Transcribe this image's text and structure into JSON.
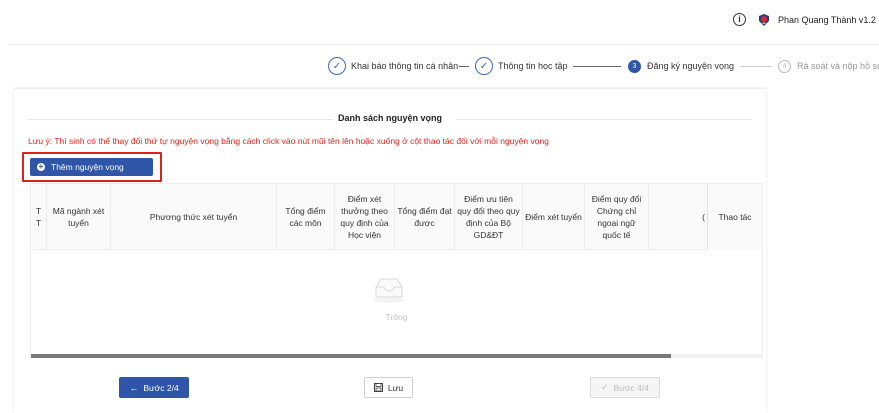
{
  "header": {
    "info_icon": "info-circle-icon",
    "avatar_icon": "user-avatar-icon",
    "user_name": "Phan Quang Thành v1.2"
  },
  "stepper": {
    "steps": [
      {
        "number": "✓",
        "label": "Khai báo thông tin cá nhân",
        "state": "done"
      },
      {
        "number": "✓",
        "label": "Thông tin học tập",
        "state": "done"
      },
      {
        "number": "3",
        "label": "Đăng ký nguyện vọng",
        "state": "active"
      },
      {
        "number": "4",
        "label": "Rà soát và nộp hồ sơ",
        "state": "pending"
      }
    ]
  },
  "panel": {
    "title": "Danh sách nguyện vọng",
    "notice": "Lưu ý: Thí sinh có thể thay đổi thứ tự nguyện vọng bằng cách click vào nút mũi tên lên hoặc xuống ở cột thao tác đối với mỗi nguyện vọng",
    "add_button": "Thêm nguyện vọng"
  },
  "table": {
    "columns": [
      "T T",
      "Mã ngành xét tuyển",
      "Phương thức xét tuyển",
      "Tổng điểm các môn",
      "Điểm xét thưởng theo quy định của Học viện",
      "Tổng điểm đạt được",
      "Điểm ưu tiên quy đổi theo quy định của Bộ GD&ĐT",
      "Điểm xét tuyển",
      "Điểm quy đổi Chứng chỉ ngoại ngữ quốc tế",
      "(",
      "Thao tác"
    ],
    "empty_text": "Trống",
    "scroll_fraction": 0.875
  },
  "footer": {
    "prev_label": "Bước 2/4",
    "save_label": "Lưu",
    "next_label": "Bước 4/4"
  },
  "colors": {
    "primary": "#2f55a9",
    "warning": "#e0241b"
  }
}
